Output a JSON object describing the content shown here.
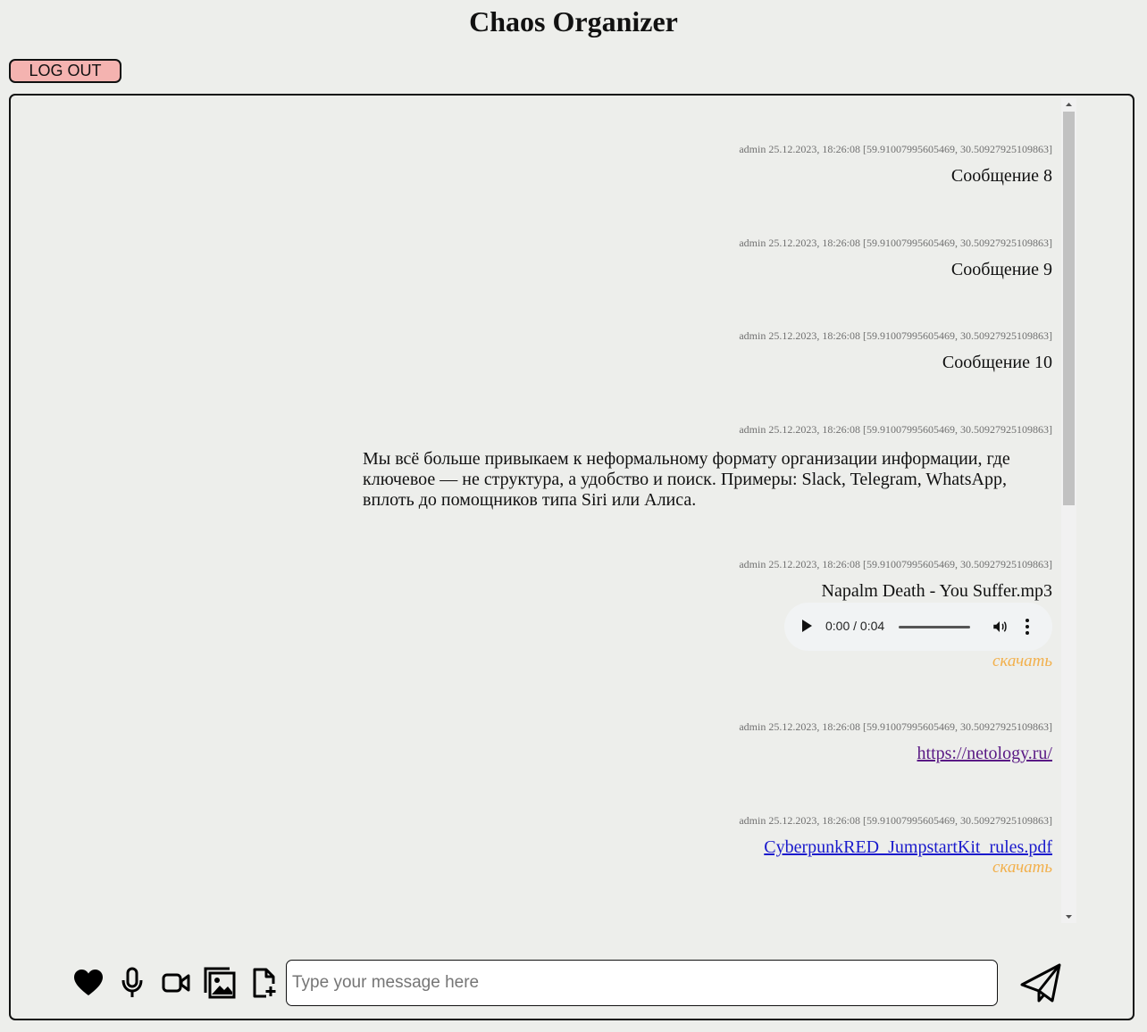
{
  "app": {
    "title": "Chaos Organizer",
    "logout_label": "LOG OUT"
  },
  "messages": [
    {
      "meta": "admin 25.12.2023, 18:26:08 [59.91007995605469, 30.50927925109863]",
      "text": "Сообщение 8"
    },
    {
      "meta": "admin 25.12.2023, 18:26:08 [59.91007995605469, 30.50927925109863]",
      "text": "Сообщение 9"
    },
    {
      "meta": "admin 25.12.2023, 18:26:08 [59.91007995605469, 30.50927925109863]",
      "text": "Сообщение 10"
    },
    {
      "meta": "admin 25.12.2023, 18:26:08 [59.91007995605469, 30.50927925109863]",
      "text": "Мы всё больше привыкаем к неформальному формату организации информации, где ключевое — не структура, а удобство и поиск. Примеры: Slack, Telegram, WhatsApp, вплоть до помощников типа Siri или Алиса."
    },
    {
      "meta": "admin 25.12.2023, 18:26:08 [59.91007995605469, 30.50927925109863]",
      "filename": "Napalm Death - You Suffer.mp3",
      "audio_time": "0:00 / 0:04",
      "download": "скачать"
    },
    {
      "meta": "admin 25.12.2023, 18:26:08 [59.91007995605469, 30.50927925109863]",
      "link": "https://netology.ru/"
    },
    {
      "meta": "admin 25.12.2023, 18:26:08 [59.91007995605469, 30.50927925109863]",
      "file": "CyberpunkRED_JumpstartKit_rules.pdf",
      "download": "скачать"
    }
  ],
  "composer": {
    "placeholder": "Type your message here",
    "value": ""
  },
  "icons": [
    "heart-icon",
    "microphone-icon",
    "video-camera-icon",
    "image-gallery-icon",
    "add-file-icon",
    "send-icon"
  ],
  "colors": {
    "background": "#edeeeb",
    "logout_button": "#f4b3b0",
    "download_link": "#f2b04c",
    "visited_link": "#5a1a85",
    "file_link": "#1a1acc"
  }
}
